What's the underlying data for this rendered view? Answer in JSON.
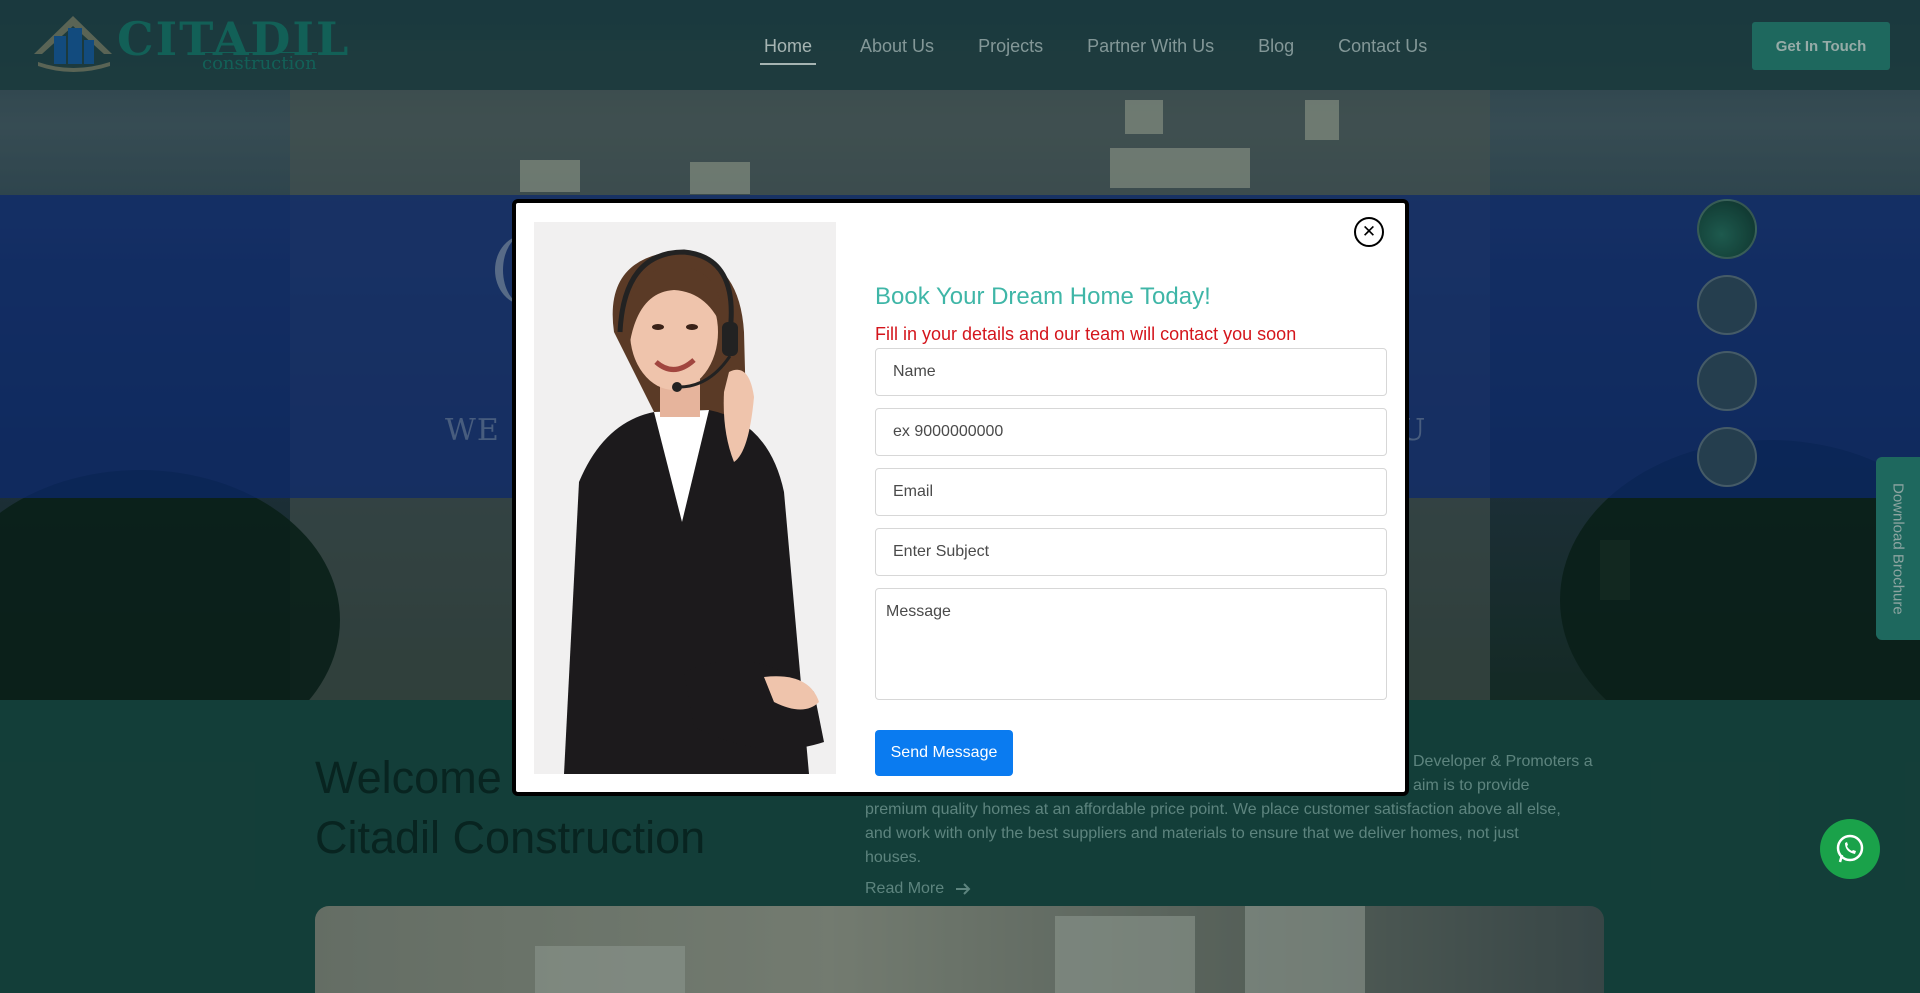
{
  "header": {
    "logo_name": "CITADIL",
    "logo_sub": "construction",
    "nav": [
      {
        "label": "Home"
      },
      {
        "label": "About Us"
      },
      {
        "label": "Projects"
      },
      {
        "label": "Partner With Us"
      },
      {
        "label": "Blog"
      },
      {
        "label": "Contact Us"
      }
    ],
    "active_nav": "Home",
    "cta_label": "Get In Touch"
  },
  "hero": {
    "text_left": "WE",
    "text_right": "U"
  },
  "side": {
    "brochure_label": "Download Brochure"
  },
  "about": {
    "welcome_line1": "Welcome",
    "welcome_line2": "Citadil Construction",
    "text_line1": "Developer & Promoters a",
    "text_line2": "aim is to provide",
    "text_line3": "premium quality homes at an affordable price point. We place customer satisfaction above all else,",
    "text_line4": "and work with only the best suppliers and materials to ensure that we deliver homes, not just",
    "text_line5": "houses.",
    "read_more": "Read More"
  },
  "modal": {
    "title": "Book Your Dream Home Today!",
    "subtitle": "Fill in your details and our team will contact you soon",
    "fields": {
      "name_placeholder": "Name",
      "phone_placeholder": "ex 9000000000",
      "email_placeholder": "Email",
      "subject_placeholder": "Enter Subject",
      "message_placeholder": "Message"
    },
    "send_label": "Send Message",
    "close_glyph": "✕"
  },
  "colors": {
    "accent": "#2f8b7f",
    "modal_title": "#3fb6a7",
    "modal_subtitle": "#d4151c",
    "send_button": "#0a7bf0",
    "whatsapp": "#1aa24a"
  },
  "icons": {
    "close": "close-icon",
    "whatsapp": "whatsapp-icon",
    "arrow": "arrow-right-icon"
  }
}
